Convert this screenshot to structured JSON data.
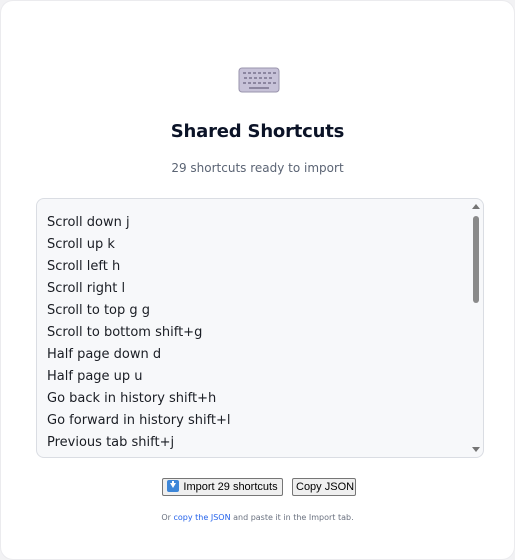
{
  "header": {
    "icon": "keyboard-icon",
    "title": "Shared Shortcuts",
    "subtitle": "29 shortcuts ready to import"
  },
  "shortcuts": [
    "Scroll down j",
    "Scroll up k",
    "Scroll left h",
    "Scroll right l",
    "Scroll to top g g",
    "Scroll to bottom shift+g",
    "Half page down d",
    "Half page up u",
    "Go back in history shift+h",
    "Go forward in history shift+l",
    "Previous tab shift+j"
  ],
  "actions": {
    "import_icon": "download-icon",
    "import_label": "Import 29 shortcuts",
    "copy_label": "Copy JSON"
  },
  "footer": {
    "prefix": "Or ",
    "link_label": "copy the JSON",
    "suffix": " and paste it in the Import tab."
  },
  "colors": {
    "title": "#0b1327",
    "link": "#2563eb",
    "import_icon": "#3d86d8"
  }
}
